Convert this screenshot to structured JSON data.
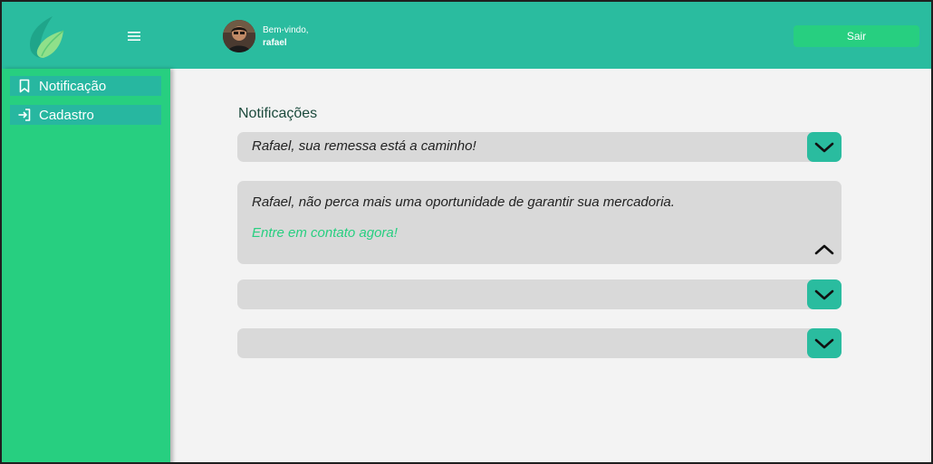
{
  "header": {
    "welcome_label": "Bem-vindo,",
    "user_name": "rafael",
    "logout_label": "Sair"
  },
  "sidebar": {
    "items": [
      {
        "label": "Notificação",
        "icon": "bookmark-icon"
      },
      {
        "label": "Cadastro",
        "icon": "login-arrow-icon"
      }
    ]
  },
  "main": {
    "title": "Notificações",
    "notifications": [
      {
        "text": "Rafael, sua remessa está a caminho!",
        "expanded": false
      },
      {
        "text": "Rafael, não perca mais uma oportunidade de garantir sua mercadoria.",
        "link": "Entre em contato agora!",
        "expanded": true
      },
      {
        "text": "",
        "expanded": false
      },
      {
        "text": "",
        "expanded": false
      }
    ]
  },
  "colors": {
    "header_bg": "#2abc9f",
    "sidebar_bg": "#27cf80",
    "sidebar_item_bg": "#27b7a0",
    "button_bg": "#27cf80",
    "card_bg": "#d9d9d9",
    "link": "#27cf80",
    "page_bg": "#f3f3f3"
  }
}
